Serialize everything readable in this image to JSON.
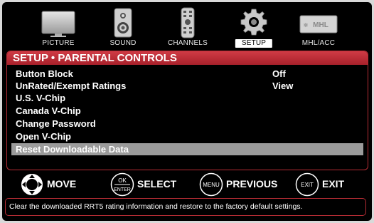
{
  "tabs": [
    {
      "label": "PICTURE",
      "icon": "tv-icon",
      "active": false
    },
    {
      "label": "SOUND",
      "icon": "speaker-icon",
      "active": false
    },
    {
      "label": "CHANNELS",
      "icon": "remote-icon",
      "active": false
    },
    {
      "label": "SETUP",
      "icon": "gear-icon",
      "active": true
    },
    {
      "label": "MHL/ACC",
      "icon": "mhl-logo-icon",
      "active": false,
      "logo_text": "MHL"
    }
  ],
  "panel": {
    "title": "SETUP • PARENTAL CONTROLS",
    "items": [
      {
        "label": "Button Block",
        "value": "Off"
      },
      {
        "label": "UnRated/Exempt Ratings",
        "value": "View"
      },
      {
        "label": "U.S. V-Chip",
        "value": ""
      },
      {
        "label": "Canada V-Chip",
        "value": ""
      },
      {
        "label": "Change Password",
        "value": ""
      },
      {
        "label": "Open V-Chip",
        "value": ""
      },
      {
        "label": "Reset Downloadable Data",
        "value": "",
        "selected": true
      }
    ]
  },
  "nav": {
    "move": {
      "label": "MOVE"
    },
    "select": {
      "label": "SELECT",
      "icon_line1": "OK",
      "icon_line2": "ENTER"
    },
    "previous": {
      "label": "PREVIOUS",
      "icon_text": "MENU"
    },
    "exit": {
      "label": "EXIT",
      "icon_text": "EXIT"
    }
  },
  "help_text": "Clear the downloaded RRT5 rating information and restore to the factory default settings.",
  "colors": {
    "accent": "#b62c34",
    "selected_row": "#9b9b9b",
    "background": "#000000"
  }
}
